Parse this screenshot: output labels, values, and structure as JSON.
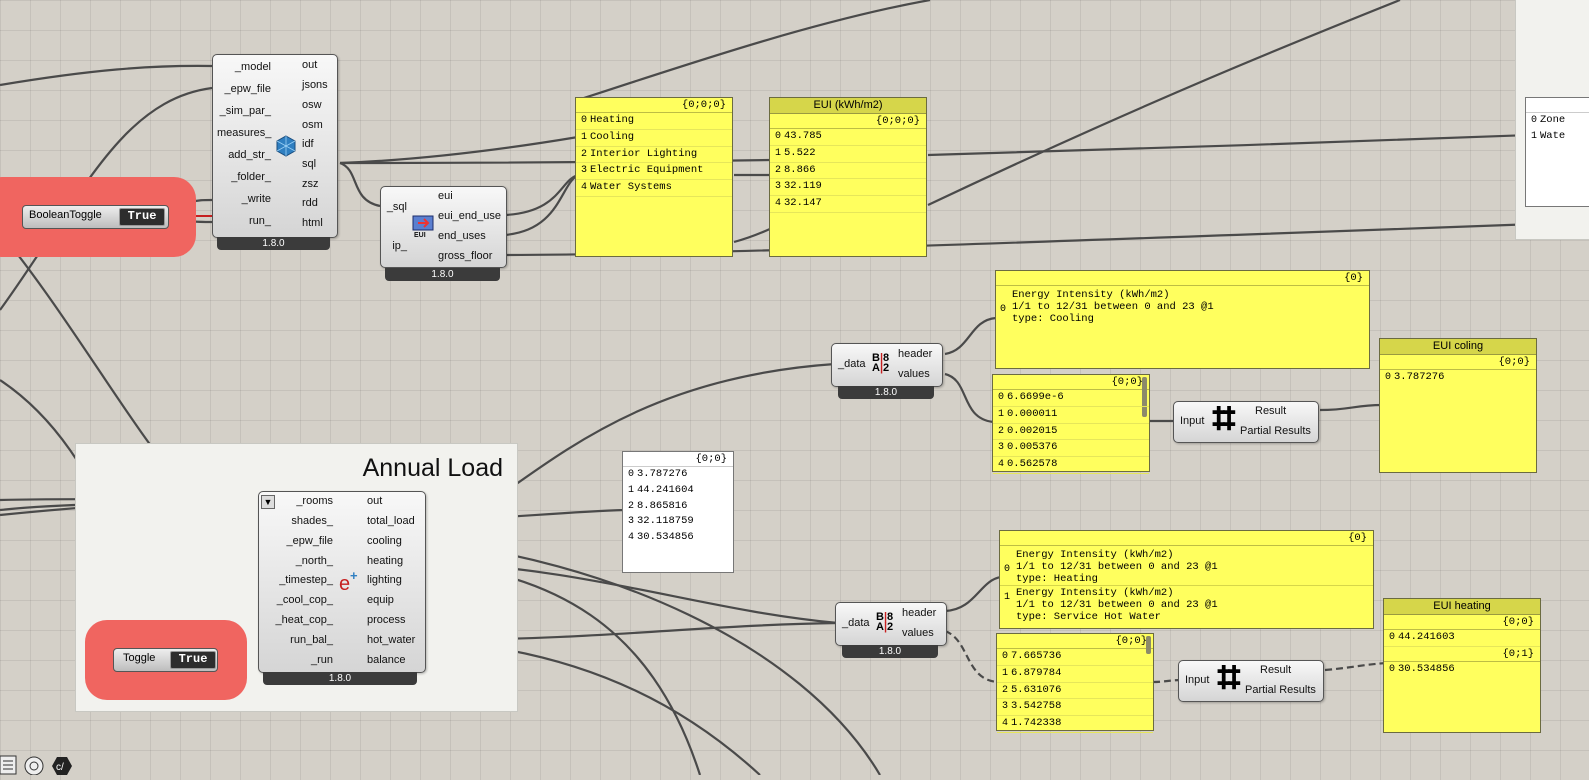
{
  "groups": {
    "annual_load_title": "Annual Load"
  },
  "run_component": {
    "inputs": [
      "_model",
      "_epw_file",
      "_sim_par_",
      "measures_",
      "add_str_",
      "_folder_",
      "_write",
      "run_"
    ],
    "outputs": [
      "out",
      "jsons",
      "osw",
      "osm",
      "idf",
      "sql",
      "zsz",
      "rdd",
      "html"
    ],
    "version": "1.8.0"
  },
  "eui_component": {
    "inputs": [
      "_sql",
      "ip_"
    ],
    "outputs": [
      "eui",
      "eui_end_use",
      "end_uses",
      "gross_floor"
    ],
    "icon_label": "EUI",
    "version": "1.8.0"
  },
  "boolean_toggle_1": {
    "label": "BooleanToggle",
    "value": "True"
  },
  "toggle_2": {
    "label": "Toggle",
    "value": "True"
  },
  "end_uses_panel": {
    "path": "{0;0;0}",
    "rows": [
      "Heating",
      "Cooling",
      "Interior Lighting",
      "Electric Equipment",
      "Water Systems"
    ]
  },
  "eui_panel": {
    "title": "EUI (kWh/m2)",
    "path": "{0;0;0}",
    "rows": [
      "43.785",
      "5.522",
      "8.866",
      "32.119",
      "32.147"
    ]
  },
  "zone_panel": {
    "rows": [
      "Zone",
      "Wate"
    ]
  },
  "annual_load_component": {
    "inputs": [
      "_rooms",
      "shades_",
      "_epw_file",
      "_north_",
      "_timestep_",
      "_cool_cop_",
      "_heat_cop_",
      "run_bal_",
      "_run"
    ],
    "outputs": [
      "out",
      "total_load",
      "cooling",
      "heating",
      "lighting",
      "equip",
      "process",
      "hot_water",
      "balance"
    ],
    "version": "1.8.0"
  },
  "total_load_panel": {
    "path": "{0;0}",
    "rows": [
      "3.787276",
      "44.241604",
      "8.865816",
      "32.118759",
      "30.534856"
    ]
  },
  "deconstruct_1": {
    "inputs": [
      "_data"
    ],
    "outputs": [
      "header",
      "values"
    ],
    "version": "1.8.0"
  },
  "deconstruct_2": {
    "inputs": [
      "_data"
    ],
    "outputs": [
      "header",
      "values"
    ],
    "version": "1.8.0"
  },
  "header_panel_cooling": {
    "path": "{0}",
    "rows": [
      [
        "Energy Intensity (kWh/m2)",
        "1/1 to 12/31 between 0 and 23 @1",
        "type: Cooling"
      ]
    ]
  },
  "header_panel_heating": {
    "path": "{0}",
    "rows": [
      [
        "Energy Intensity (kWh/m2)",
        "1/1 to 12/31 between 0 and 23 @1",
        "type: Heating"
      ],
      [
        "Energy Intensity (kWh/m2)",
        "1/1 to 12/31 between 0 and 23 @1",
        "type: Service Hot Water"
      ]
    ]
  },
  "values_panel_cooling": {
    "path": "{0;0}",
    "rows": [
      "6.6699e-6",
      "0.000011",
      "0.002015",
      "0.005376",
      "0.562578"
    ]
  },
  "values_panel_heating": {
    "path": "{0;0}",
    "rows": [
      "7.665736",
      "6.879784",
      "5.631076",
      "3.542758",
      "1.742338"
    ]
  },
  "mass_addition_1": {
    "inputs": [
      "Input"
    ],
    "outputs": [
      "Result",
      "Partial Results"
    ]
  },
  "mass_addition_2": {
    "inputs": [
      "Input"
    ],
    "outputs": [
      "Result",
      "Partial Results"
    ]
  },
  "eui_cooling_panel": {
    "title": "EUI coling",
    "path": "{0;0}",
    "rows": [
      "3.787276"
    ]
  },
  "eui_heating_panel": {
    "title": "EUI heating",
    "branches": [
      {
        "path": "{0;0}",
        "rows": [
          "44.241603"
        ]
      },
      {
        "path": "{0;1}",
        "rows": [
          "30.534856"
        ]
      }
    ]
  },
  "colors": {
    "canvas": "#d4d0c8",
    "panel_yellow": "#ffff5e",
    "group_red": "#f06560",
    "wire": "#4a4a4a"
  }
}
